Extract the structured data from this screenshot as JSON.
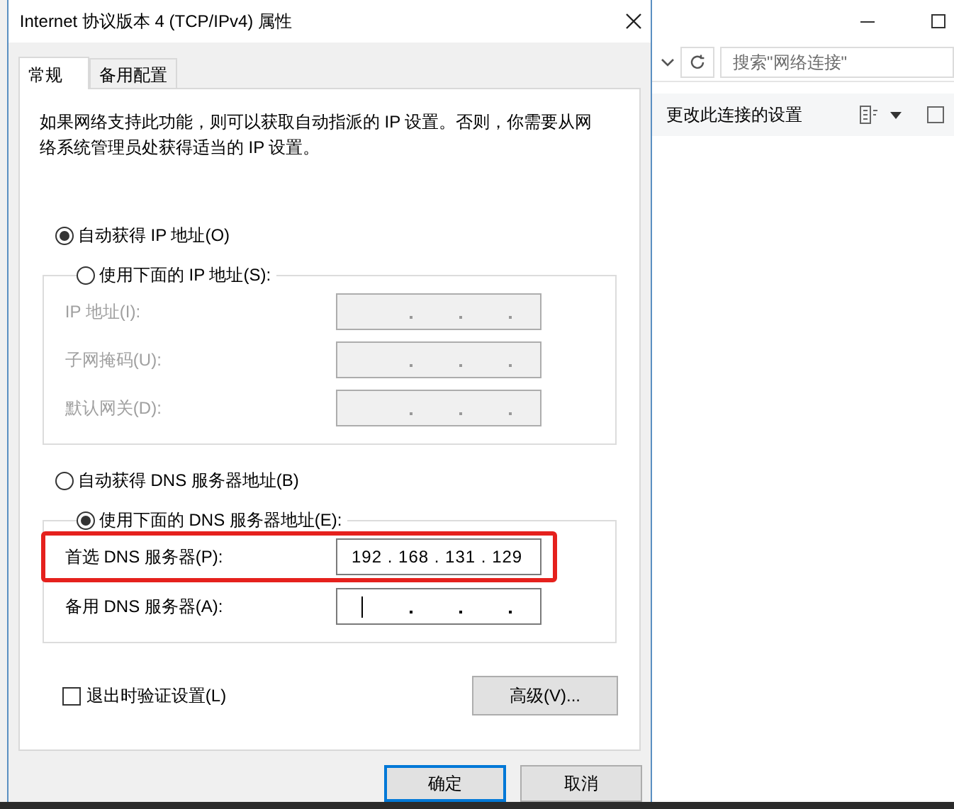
{
  "dialog": {
    "title": "Internet 协议版本 4 (TCP/IPv4) 属性",
    "tabs": [
      {
        "label": "常规",
        "selected": true
      },
      {
        "label": "备用配置",
        "selected": false
      }
    ],
    "description": "如果网络支持此功能，则可以获取自动指派的 IP 设置。否则，你需要从网络系统管理员处获得适当的 IP 设置。",
    "ip_section": {
      "auto_option": {
        "label": "自动获得 IP 地址(O)",
        "selected": true
      },
      "manual_option": {
        "label": "使用下面的 IP 地址(S):",
        "selected": false
      },
      "fields": [
        {
          "label": "IP 地址(I):",
          "disabled": true
        },
        {
          "label": "子网掩码(U):",
          "disabled": true
        },
        {
          "label": "默认网关(D):",
          "disabled": true
        }
      ]
    },
    "dns_section": {
      "auto_option": {
        "label": "自动获得 DNS 服务器地址(B)",
        "selected": false
      },
      "manual_option": {
        "label": "使用下面的 DNS 服务器地址(E):",
        "selected": true
      },
      "fields": [
        {
          "label": "首选 DNS 服务器(P):",
          "disabled": false,
          "value": "192 . 168 . 131 . 129",
          "highlighted": true
        },
        {
          "label": "备用 DNS 服务器(A):",
          "disabled": false,
          "highlighted": false,
          "focused": true
        }
      ]
    },
    "validate_checkbox": {
      "label": "退出时验证设置(L)",
      "checked": false
    },
    "advanced_button": "高级(V)...",
    "buttons": [
      {
        "label": "确定",
        "default": true
      },
      {
        "label": "取消",
        "default": false
      }
    ]
  },
  "background_window": {
    "search": {
      "placeholder": "搜索\"网络连接\""
    },
    "toolbar_item": "更改此连接的设置"
  }
}
